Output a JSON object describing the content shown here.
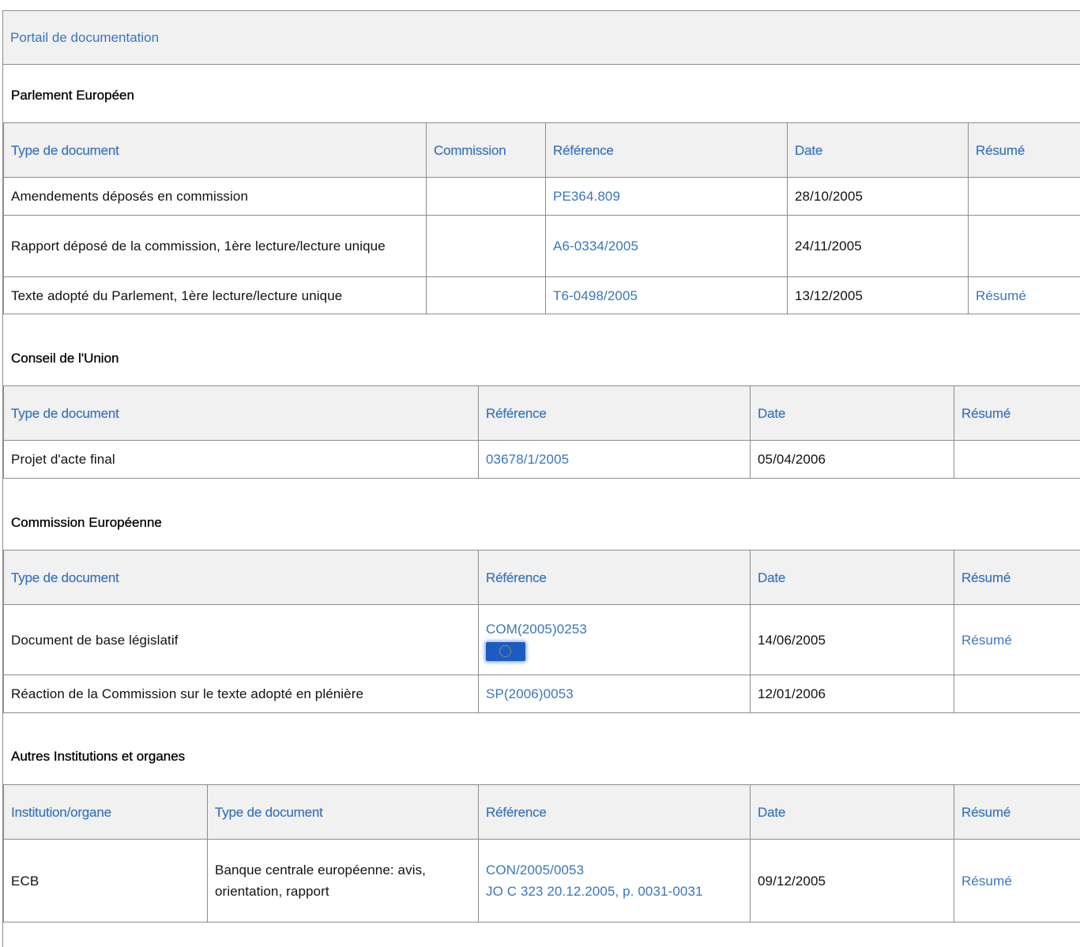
{
  "portal": {
    "title": "Portail de documentation"
  },
  "parliament": {
    "title": "Parlement Européen",
    "headers": [
      "Type de document",
      "Commission",
      "Référence",
      "Date",
      "Résumé"
    ],
    "rows": [
      {
        "type": "Amendements déposés en commission",
        "commission": "",
        "reference": "PE364.809",
        "date": "28/10/2005",
        "summary": ""
      },
      {
        "type": "Rapport déposé de la commission, 1ère lecture/lecture unique",
        "commission": "",
        "reference": "A6-0334/2005",
        "date": "24/11/2005",
        "summary": ""
      },
      {
        "type": "Texte adopté du Parlement, 1ère lecture/lecture unique",
        "commission": "",
        "reference": "T6-0498/2005",
        "date": "13/12/2005",
        "summary": "Résumé"
      }
    ]
  },
  "council": {
    "title": "Conseil de l'Union",
    "headers": [
      "Type de document",
      "Référence",
      "Date",
      "Résumé"
    ],
    "rows": [
      {
        "type": "Projet d'acte final",
        "reference": "03678/1/2005",
        "date": "05/04/2006",
        "summary": ""
      }
    ]
  },
  "commission": {
    "title": "Commission Européenne",
    "headers": [
      "Type de document",
      "Référence",
      "Date",
      "Résumé"
    ],
    "rows": [
      {
        "type": "Document de base législatif",
        "reference": "COM(2005)0253",
        "flag_icon": "eu-flag-icon",
        "date": "14/06/2005",
        "summary": "Résumé"
      },
      {
        "type": "Réaction de la Commission sur le texte adopté en plénière",
        "reference": "SP(2006)0053",
        "date": "12/01/2006",
        "summary": ""
      }
    ]
  },
  "others": {
    "title": "Autres Institutions et organes",
    "headers": [
      "Institution/organe",
      "Type de document",
      "Référence",
      "Date",
      "Résumé"
    ],
    "rows": [
      {
        "institution": "ECB",
        "type": "Banque centrale européenne: avis, orientation, rapport",
        "reference": "CON/2005/0053",
        "reference2": "JO C 323 20.12.2005, p. 0031-0031",
        "date": "09/12/2005",
        "summary": "Résumé"
      }
    ]
  },
  "colors": {
    "link": "#3a76bd",
    "header_bg": "#f1f1f1",
    "border": "#8c8c8c"
  }
}
